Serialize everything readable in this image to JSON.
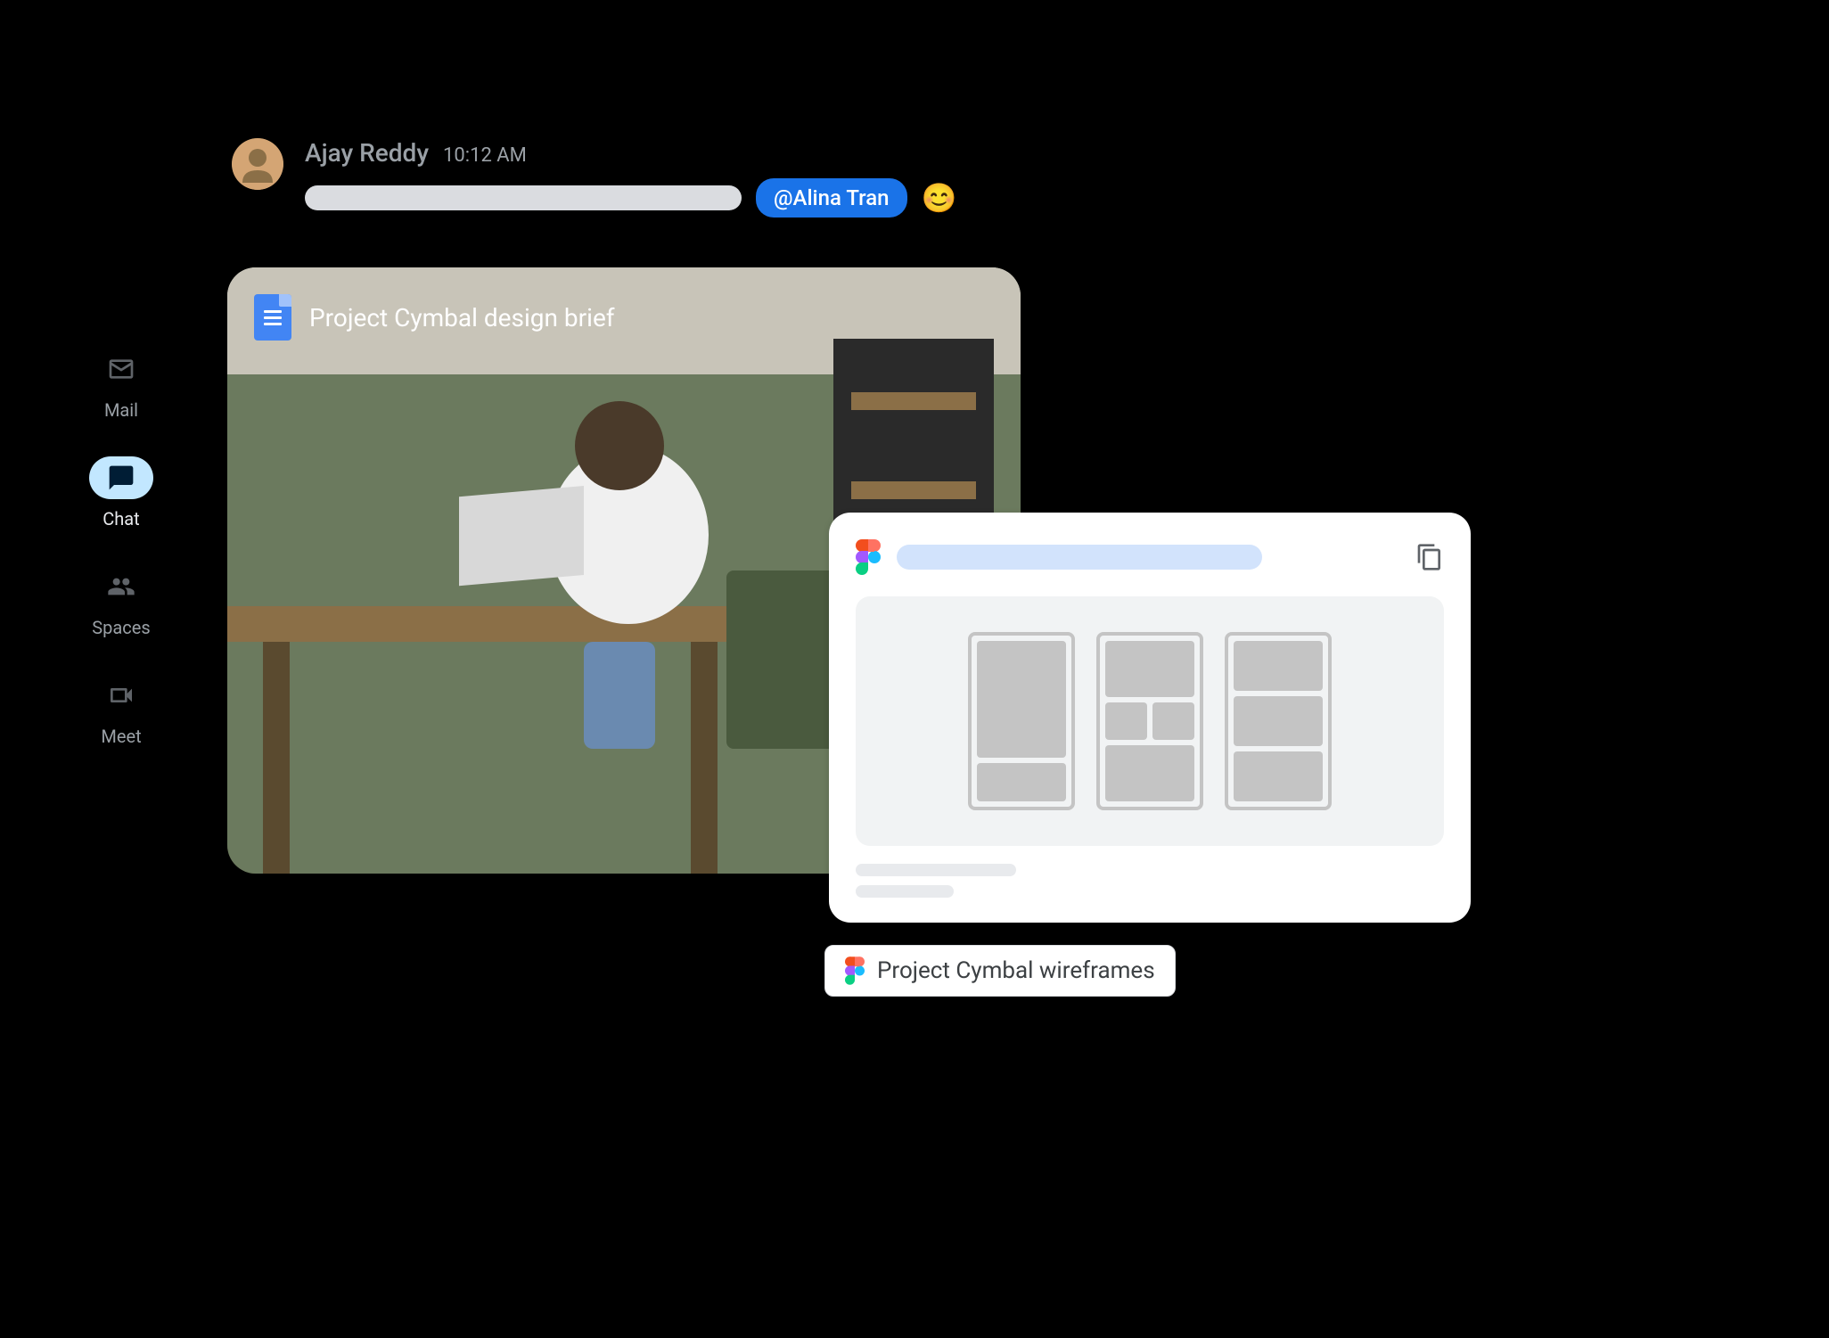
{
  "sidebar": {
    "items": [
      {
        "label": "Mail",
        "icon": "mail-icon",
        "active": false
      },
      {
        "label": "Chat",
        "icon": "chat-icon",
        "active": true
      },
      {
        "label": "Spaces",
        "icon": "spaces-icon",
        "active": false
      },
      {
        "label": "Meet",
        "icon": "meet-icon",
        "active": false
      }
    ]
  },
  "message": {
    "sender": "Ajay Reddy",
    "timestamp": "10:12 AM",
    "mention": "@Alina Tran",
    "emoji": "😊"
  },
  "attachment": {
    "title": "Project Cymbal design brief",
    "type": "google-doc"
  },
  "figma_card": {
    "chip_label": "Project Cymbal wireframes"
  }
}
